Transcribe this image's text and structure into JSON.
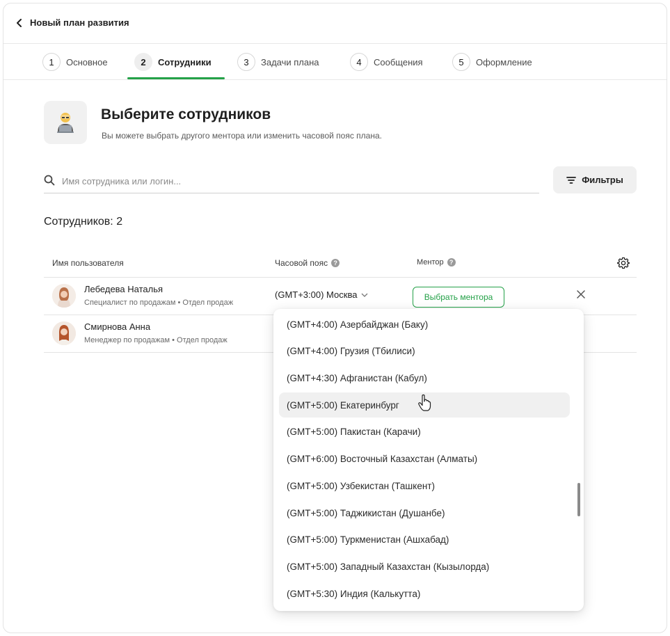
{
  "header": {
    "title": "Новый план развития"
  },
  "steps": [
    {
      "num": "1",
      "label": "Основное"
    },
    {
      "num": "2",
      "label": "Сотрудники"
    },
    {
      "num": "3",
      "label": "Задачи плана"
    },
    {
      "num": "4",
      "label": "Сообщения"
    },
    {
      "num": "5",
      "label": "Оформление"
    }
  ],
  "active_step": 2,
  "hero": {
    "title": "Выберите сотрудников",
    "subtitle": "Вы можете выбрать другого ментора или изменить часовой пояс плана."
  },
  "search": {
    "placeholder": "Имя сотрудника или логин..."
  },
  "filters_label": "Фильтры",
  "count_label": "Сотрудников: 2",
  "table": {
    "headers": {
      "name": "Имя пользователя",
      "timezone": "Часовой пояс",
      "mentor": "Ментор"
    },
    "rows": [
      {
        "name": "Лебедева Наталья",
        "meta": "Специалист по продажам • Отдел продаж",
        "timezone": "(GMT+3:00) Москва",
        "mentor_button": "Выбрать ментора"
      },
      {
        "name": "Смирнова Анна",
        "meta": "Менеджер по продажам • Отдел продаж"
      }
    ]
  },
  "dropdown": {
    "options": [
      "(GMT+4:00) Азербайджан (Баку)",
      "(GMT+4:00) Грузия (Тбилиси)",
      "(GMT+4:30) Афганистан (Кабул)",
      "(GMT+5:00) Екатеринбург",
      "(GMT+5:00) Пакистан (Карачи)",
      "(GMT+6:00) Восточный Казахстан (Алматы)",
      "(GMT+5:00) Узбекистан (Ташкент)",
      "(GMT+5:00) Таджикистан (Душанбе)",
      "(GMT+5:00) Туркменистан (Ашхабад)",
      "(GMT+5:00) Западный Казахстан (Кызылорда)",
      "(GMT+5:30) Индия (Калькутта)"
    ],
    "hovered_option": "(GMT+5:00) Екатеринбург"
  },
  "colors": {
    "accent": "#24a148",
    "border": "#e3e3e3",
    "hover": "#f0f0f0"
  }
}
